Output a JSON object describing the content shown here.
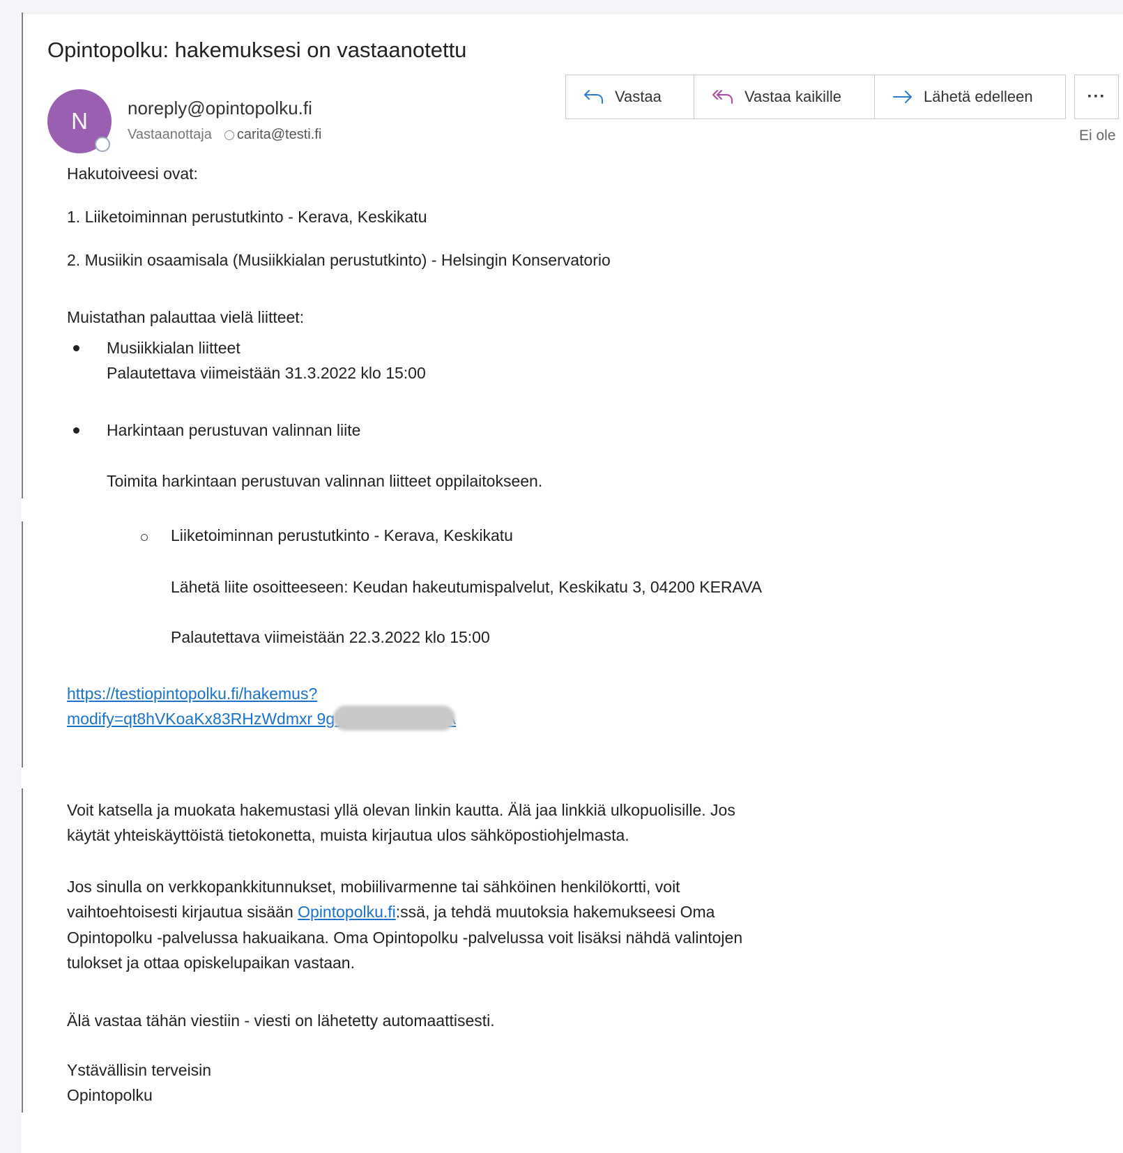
{
  "email": {
    "subject": "Opintopolku: hakemuksesi on vastaanotettu",
    "avatar_initial": "N",
    "sender": "noreply@opintopolku.fi",
    "recipient_label": "Vastaanottaja",
    "recipient_email": "carita@testi.fi",
    "flag_text": "Ei ole"
  },
  "actions": {
    "reply": "Vastaa",
    "reply_all": "Vastaa kaikille",
    "forward": "Lähetä edelleen",
    "more": "···"
  },
  "body": {
    "wishes_heading": "Hakutoiveesi ovat:",
    "wish_1": "1. Liiketoiminnan perustutkinto - Kerava, Keskikatu",
    "wish_2": "2. Musiikin osaamisala (Musiikkialan perustutkinto) - Helsingin Konservatorio",
    "attachments_heading": "Muistathan palauttaa vielä liitteet:",
    "attachment_1_title": "Musiikkialan liitteet",
    "attachment_1_deadline": "Palautettava viimeistään 31.3.2022 klo 15:00",
    "attachment_2_title": "Harkintaan perustuvan valinnan liite",
    "attachment_2_instruction": "Toimita harkintaan perustuvan valinnan liitteet oppilaitokseen.",
    "sub_item_title": "Liiketoiminnan perustutkinto - Kerava, Keskikatu",
    "sub_item_address": "Lähetä liite osoitteeseen: Keudan hakeutumispalvelut, Keskikatu 3, 04200 KERAVA",
    "sub_item_deadline": "Palautettava viimeistään 22.3.2022 klo 15:00",
    "link_line_1": "https://testiopintopolku.fi/hakemus?",
    "link_line_2": "modify=qt8hVKoaKx83RHzWdmxr          9gUN7xQfXn7IzIxA",
    "info_1_line_1": "Voit katsella ja muokata hakemustasi yllä olevan linkin kautta. Älä jaa linkkiä ulkopuolisille. Jos",
    "info_1_line_2": "käytät yhteiskäyttöistä tietokonetta, muista kirjautua ulos sähköpostiohjelmasta.",
    "info_2_line_1": "Jos sinulla on verkkopankkitunnukset, mobiilivarmenne tai sähköinen henkilökortti, voit",
    "info_2_line_2_pre": "vaihtoehtoisesti kirjautua sisään ",
    "info_2_line_2_link": "Opintopolku.fi",
    "info_2_line_2_post": ":ssä, ja tehdä muutoksia hakemukseesi Oma",
    "info_2_line_3": "Opintopolku -palvelussa hakuaikana. Oma Opintopolku -palvelussa voit lisäksi nähdä valintojen",
    "info_2_line_4": "tulokset ja ottaa opiskelupaikan vastaan.",
    "no_reply": "Älä vastaa tähän viestiin - viesti on lähetetty automaattisesti.",
    "closing_1": "Ystävällisin terveisin",
    "closing_2": "Opintopolku"
  },
  "colors": {
    "avatar": "#9b5fb2",
    "link": "#1a73c9",
    "accent_icon": "#2b7cd3",
    "reply_all_icon": "#b046a8"
  }
}
